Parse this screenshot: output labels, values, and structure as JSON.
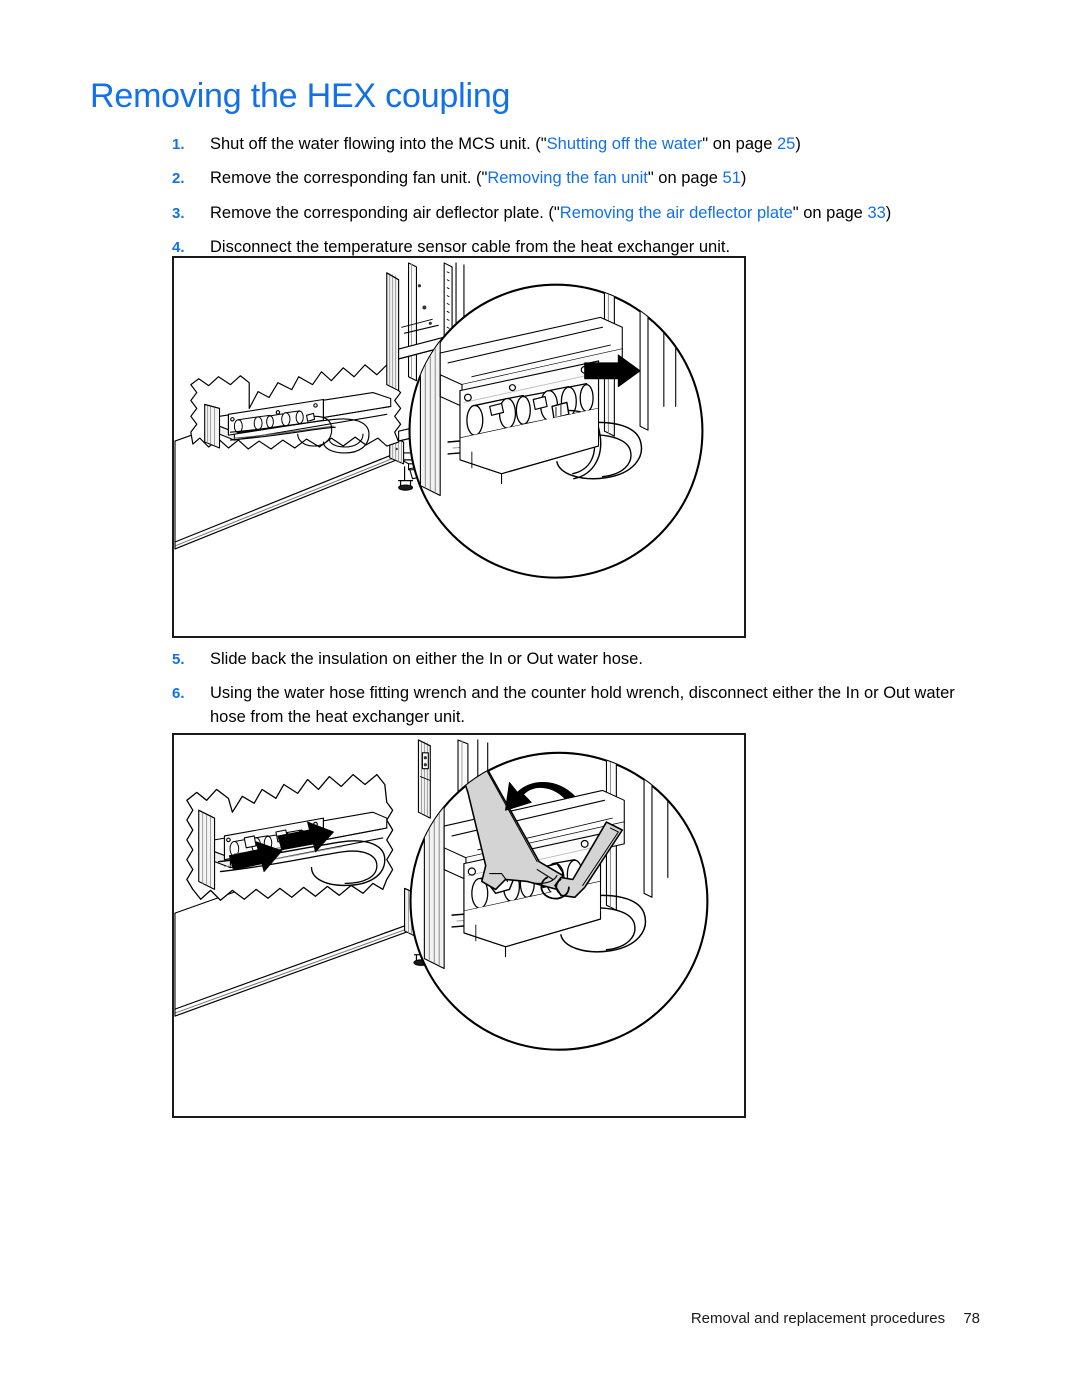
{
  "document": {
    "title": "Removing the HEX coupling",
    "title_color": "#1271e8",
    "link_color": "#1271e8",
    "body_color": "#000000",
    "background": "#ffffff"
  },
  "steps_group_1": [
    {
      "number": "1.",
      "text_before": "Shut off the water flowing into the MCS unit. (\"",
      "link": "Shutting off the water",
      "text_mid": "\" on page ",
      "page": "25",
      "text_after": ")"
    },
    {
      "number": "2.",
      "text_before": "Remove the corresponding fan unit. (\"",
      "link": "Removing the fan unit",
      "text_mid": "\" on page ",
      "page": "51",
      "text_after": ")"
    },
    {
      "number": "3.",
      "text_before": "Remove the corresponding air deflector plate. (\"",
      "link": "Removing the air deflector plate",
      "text_mid": "\" on page ",
      "page": "33",
      "text_after": ")"
    },
    {
      "number": "4.",
      "text_before": "Disconnect the temperature sensor cable from the heat exchanger unit.",
      "link": "",
      "text_mid": "",
      "page": "",
      "text_after": ""
    }
  ],
  "steps_group_2": [
    {
      "number": "5.",
      "text_before": "Slide back the insulation on either the In or Out water hose.",
      "link": "",
      "text_mid": "",
      "page": "",
      "text_after": ""
    },
    {
      "number": "6.",
      "text_before": "Using the water hose fitting wrench and the counter hold wrench, disconnect either the In or Out water hose from the heat exchanger unit.",
      "link": "",
      "text_mid": "",
      "page": "",
      "text_after": ""
    }
  ],
  "figures": [
    {
      "id": "figure-temperature-sensor-cable",
      "caption": "Line drawing of MCS rack showing temperature sensor cable disconnection with magnified detail callout and black direction arrow",
      "callout": "magnified-circle",
      "arrows": [
        "black-arrow-right"
      ],
      "line_color": "#000000",
      "fill_color": "#ffffff",
      "shade_color": "#d9d9d9"
    },
    {
      "id": "figure-water-hose-wrench",
      "caption": "Line drawing of MCS rack showing water hose fitting wrench and counter hold wrench with magnified detail callout, black direction arrows and rotation arrow",
      "callout": "magnified-circle",
      "arrows": [
        "black-arrow-right",
        "black-arrow-right",
        "curved-rotation-arrow"
      ],
      "line_color": "#000000",
      "fill_color": "#ffffff",
      "shade_color": "#cccccc"
    }
  ],
  "footer": {
    "chapter": "Removal and replacement procedures",
    "page_number": "78"
  }
}
